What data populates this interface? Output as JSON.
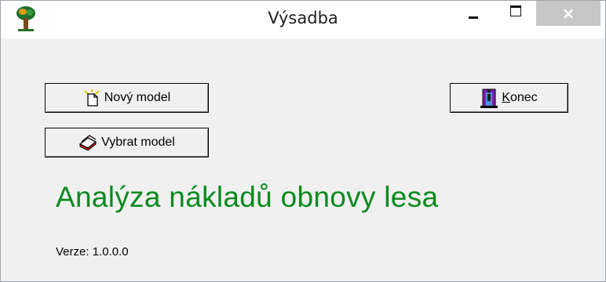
{
  "window": {
    "title": "Výsadba",
    "close_glyph": "×"
  },
  "buttons": {
    "new_model": "Nový model",
    "pick_model": "Vybrat model",
    "end_first_letter": "K",
    "end_rest": "onec"
  },
  "main": {
    "heading": "Analýza nákladů obnovy lesa",
    "version": "Verze: 1.0.0.0"
  },
  "icons": {
    "app": "tree-app-icon",
    "new_model": "new-document-icon",
    "pick_model": "open-files-icon",
    "end": "exit-door-icon"
  },
  "colors": {
    "heading": "#0a8a1e",
    "close_button": "#c7c7c7",
    "window_bg": "#f0f0f0"
  }
}
